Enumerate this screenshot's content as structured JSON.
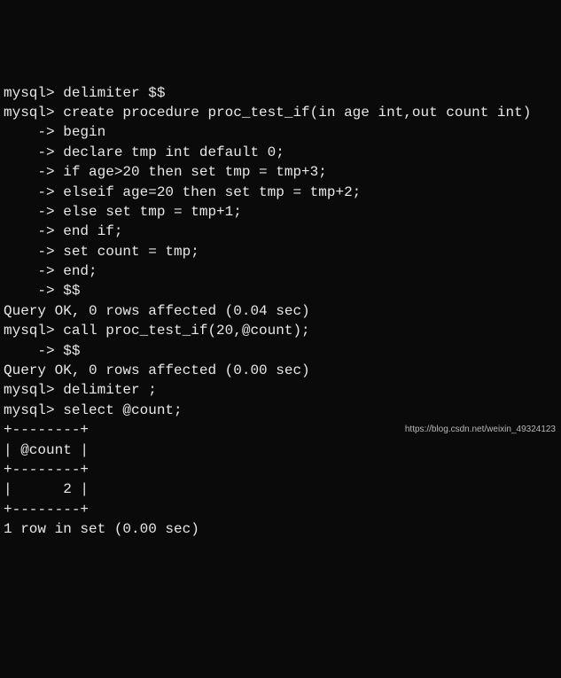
{
  "terminal": {
    "lines": [
      "mysql> delimiter $$",
      "mysql> create procedure proc_test_if(in age int,out count int)",
      "    -> begin",
      "    -> declare tmp int default 0;",
      "    -> if age>20 then set tmp = tmp+3;",
      "    -> elseif age=20 then set tmp = tmp+2;",
      "    -> else set tmp = tmp+1;",
      "    -> end if;",
      "    -> set count = tmp;",
      "    -> end;",
      "    -> $$",
      "Query OK, 0 rows affected (0.04 sec)",
      "",
      "mysql> call proc_test_if(20,@count);",
      "    -> $$",
      "Query OK, 0 rows affected (0.00 sec)",
      "",
      "mysql> delimiter ;",
      "mysql> select @count;",
      "+--------+",
      "| @count |",
      "+--------+",
      "|      2 |",
      "+--------+",
      "1 row in set (0.00 sec)"
    ]
  },
  "watermark": "https://blog.csdn.net/weixin_49324123"
}
